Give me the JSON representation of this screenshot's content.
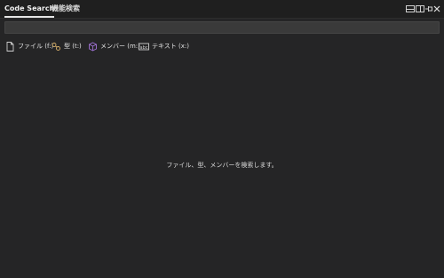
{
  "tabs": [
    {
      "label": "Code Search",
      "active": true
    },
    {
      "label": "機能検索",
      "active": false
    }
  ],
  "search": {
    "value": "",
    "placeholder": ""
  },
  "filters": [
    {
      "label": "ファイル (f:)",
      "icon": "file-icon"
    },
    {
      "label": "型 (t:)",
      "icon": "type-icon"
    },
    {
      "label": "メンバー (m:)",
      "icon": "member-cube-icon"
    },
    {
      "label": "テキスト (x:)",
      "icon": "text-abc-icon"
    }
  ],
  "empty_message": "ファイル、型、メンバーを検索します。",
  "colors": {
    "background": "#252526",
    "titlebar": "#1f1f1f",
    "member_icon": "#a072d4",
    "type_icon": "#d7b06a"
  }
}
